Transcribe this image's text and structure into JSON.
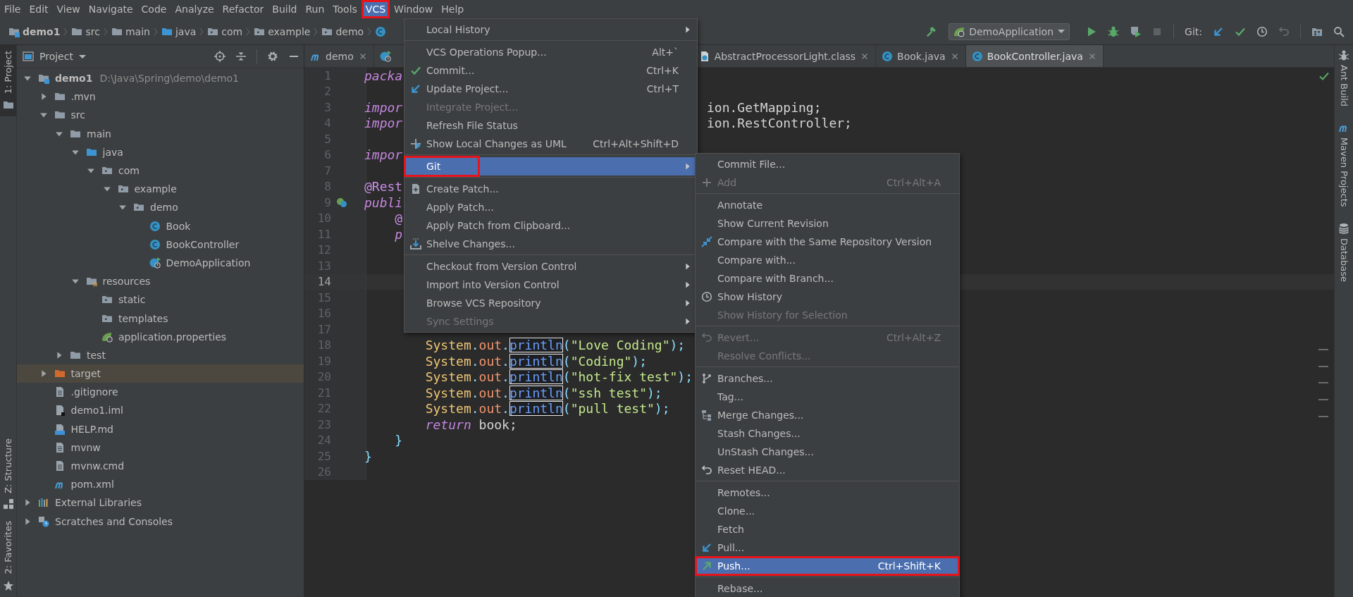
{
  "menubar": {
    "items": [
      {
        "label": "File",
        "selected": false,
        "framed": false
      },
      {
        "label": "Edit",
        "selected": false,
        "framed": false
      },
      {
        "label": "View",
        "selected": false,
        "framed": false
      },
      {
        "label": "Navigate",
        "selected": false,
        "framed": false
      },
      {
        "label": "Code",
        "selected": false,
        "framed": false
      },
      {
        "label": "Analyze",
        "selected": false,
        "framed": false
      },
      {
        "label": "Refactor",
        "selected": false,
        "framed": false
      },
      {
        "label": "Build",
        "selected": false,
        "framed": false
      },
      {
        "label": "Run",
        "selected": false,
        "framed": false
      },
      {
        "label": "Tools",
        "selected": false,
        "framed": false
      },
      {
        "label": "VCS",
        "selected": true,
        "framed": true
      },
      {
        "label": "Window",
        "selected": false,
        "framed": false
      },
      {
        "label": "Help",
        "selected": false,
        "framed": false
      }
    ]
  },
  "toolbar": {
    "breadcrumbs": [
      {
        "label": "demo1",
        "kind": "module"
      },
      {
        "label": "src",
        "kind": "folder"
      },
      {
        "label": "main",
        "kind": "folder"
      },
      {
        "label": "java",
        "kind": "folder_source"
      },
      {
        "label": "com",
        "kind": "package"
      },
      {
        "label": "example",
        "kind": "package"
      },
      {
        "label": "demo",
        "kind": "package"
      },
      {
        "kind": "class"
      }
    ],
    "run_configuration": "DemoApplication",
    "git_label": "Git:"
  },
  "left_stripe": {
    "top": [
      {
        "label": "1: Project",
        "kind": "folder",
        "selected": true
      }
    ],
    "bottom": [
      {
        "label": "Z: Structure",
        "kind": "structure",
        "selected": false
      },
      {
        "label": "2: Favorites",
        "kind": "star",
        "selected": false
      }
    ]
  },
  "right_stripe": [
    {
      "label": "Ant Build",
      "kind": "ant"
    },
    {
      "label": "Maven Projects",
      "kind": "maven"
    },
    {
      "label": "Database",
      "kind": "database"
    }
  ],
  "project": {
    "title": "Project",
    "tree": [
      {
        "label": "demo1",
        "path": "D:\\Java\\Spring\\demo\\demo1",
        "kind": "module",
        "expanded": true,
        "selected": false,
        "children": [
          {
            "label": ".mvn",
            "kind": "folder",
            "expanded": false,
            "selected": false
          },
          {
            "label": "src",
            "kind": "folder",
            "expanded": true,
            "selected": false,
            "children": [
              {
                "label": "main",
                "kind": "folder",
                "expanded": true,
                "selected": false,
                "children": [
                  {
                    "label": "java",
                    "kind": "folder_source",
                    "expanded": true,
                    "selected": false,
                    "children": [
                      {
                        "label": "com",
                        "kind": "package",
                        "expanded": true,
                        "selected": false,
                        "children": [
                          {
                            "label": "example",
                            "kind": "package",
                            "expanded": true,
                            "selected": false,
                            "children": [
                              {
                                "label": "demo",
                                "kind": "package",
                                "expanded": true,
                                "selected": false,
                                "children": [
                                  {
                                    "label": "Book",
                                    "kind": "class",
                                    "selected": false
                                  },
                                  {
                                    "label": "BookController",
                                    "kind": "class",
                                    "selected": false
                                  },
                                  {
                                    "label": "DemoApplication",
                                    "kind": "spring_class",
                                    "selected": false
                                  }
                                ]
                              }
                            ]
                          }
                        ]
                      }
                    ]
                  },
                  {
                    "label": "resources",
                    "kind": "resources",
                    "expanded": true,
                    "selected": false,
                    "children": [
                      {
                        "label": "static",
                        "kind": "package",
                        "selected": false
                      },
                      {
                        "label": "templates",
                        "kind": "package",
                        "selected": false
                      },
                      {
                        "label": "application.properties",
                        "kind": "spring_props",
                        "selected": false
                      }
                    ]
                  }
                ]
              },
              {
                "label": "test",
                "kind": "folder",
                "expanded": false,
                "selected": false
              }
            ]
          },
          {
            "label": "target",
            "kind": "excluded",
            "expanded": false,
            "selected": true
          },
          {
            "label": ".gitignore",
            "kind": "file",
            "selected": false
          },
          {
            "label": "demo1.iml",
            "kind": "iml",
            "selected": false
          },
          {
            "label": "HELP.md",
            "kind": "md",
            "selected": false
          },
          {
            "label": "mvnw",
            "kind": "file",
            "selected": false
          },
          {
            "label": "mvnw.cmd",
            "kind": "file",
            "selected": false
          },
          {
            "label": "pom.xml",
            "kind": "maven",
            "selected": false
          }
        ]
      },
      {
        "label": "External Libraries",
        "kind": "libraries",
        "expanded": false,
        "selected": false
      },
      {
        "label": "Scratches and Consoles",
        "kind": "scratches",
        "expanded": false,
        "selected": false
      }
    ]
  },
  "editor": {
    "tabs": [
      {
        "label": "demo",
        "kind": "maven",
        "selected": false
      },
      {
        "kind": "spring_class",
        "selected": false
      },
      {
        "label": "AbstractProcessorLight.class",
        "kind": "class_file",
        "selected": false
      },
      {
        "label": "Book.java",
        "kind": "class",
        "selected": false
      },
      {
        "label": "BookController.java",
        "kind": "class",
        "selected": true
      }
    ],
    "lines": [
      {
        "number": "1",
        "kind": "plain",
        "current": false,
        "segments": [
          {
            "kind": "keyword",
            "text": "packa"
          }
        ]
      },
      {
        "number": "2",
        "kind": "plain",
        "current": false
      },
      {
        "number": "3",
        "kind": "plain",
        "current": false,
        "segments": [
          {
            "kind": "keyword",
            "text": "impor"
          }
        ],
        "tail": [
          {
            "kind": "plain",
            "text": "ion.GetMapping;"
          }
        ]
      },
      {
        "number": "4",
        "kind": "plain",
        "current": false,
        "segments": [
          {
            "kind": "keyword",
            "text": "impor"
          }
        ],
        "tail": [
          {
            "kind": "plain",
            "text": "ion.RestController;"
          }
        ]
      },
      {
        "number": "5",
        "kind": "plain",
        "current": false
      },
      {
        "number": "6",
        "kind": "plain",
        "current": false,
        "segments": [
          {
            "kind": "keyword",
            "text": "impor"
          }
        ]
      },
      {
        "number": "7",
        "kind": "plain",
        "current": false
      },
      {
        "number": "8",
        "kind": "plain",
        "current": false,
        "segments": [
          {
            "kind": "annotation",
            "text": "@Rest"
          }
        ]
      },
      {
        "number": "9",
        "kind": "bean",
        "current": false,
        "segments": [
          {
            "kind": "keyword",
            "text": "publi"
          }
        ]
      },
      {
        "number": "10",
        "kind": "plain",
        "current": false,
        "segments": [
          {
            "kind": "annotation",
            "text": "    @"
          }
        ]
      },
      {
        "number": "11",
        "kind": "plain",
        "current": false,
        "segments": [
          {
            "kind": "keyword",
            "text": "    p"
          }
        ]
      },
      {
        "number": "12",
        "kind": "plain",
        "current": false
      },
      {
        "number": "13",
        "kind": "plain",
        "current": false
      },
      {
        "number": "14",
        "kind": "plain",
        "current": true
      },
      {
        "number": "15",
        "kind": "plain",
        "current": false
      },
      {
        "number": "16",
        "kind": "plain",
        "current": false
      },
      {
        "number": "17",
        "kind": "plain",
        "current": false
      },
      {
        "number": "18",
        "kind": "plain",
        "current": false,
        "segments": [
          {
            "kind": "class",
            "text": "        System"
          },
          {
            "kind": "punct",
            "text": "."
          },
          {
            "kind": "field",
            "text": "out"
          },
          {
            "kind": "punct",
            "text": "."
          },
          {
            "kind": "method_box",
            "text": "println"
          },
          {
            "kind": "punct",
            "text": "("
          },
          {
            "kind": "string",
            "text": "\"Love Coding\""
          },
          {
            "kind": "punct",
            "text": ");"
          }
        ]
      },
      {
        "number": "19",
        "kind": "plain",
        "current": false,
        "segments": [
          {
            "kind": "class",
            "text": "        System"
          },
          {
            "kind": "punct",
            "text": "."
          },
          {
            "kind": "field",
            "text": "out"
          },
          {
            "kind": "punct",
            "text": "."
          },
          {
            "kind": "method_box",
            "text": "println"
          },
          {
            "kind": "punct",
            "text": "("
          },
          {
            "kind": "string",
            "text": "\"Coding\""
          },
          {
            "kind": "punct",
            "text": ");"
          }
        ]
      },
      {
        "number": "20",
        "kind": "plain",
        "current": false,
        "segments": [
          {
            "kind": "class",
            "text": "        System"
          },
          {
            "kind": "punct",
            "text": "."
          },
          {
            "kind": "field",
            "text": "out"
          },
          {
            "kind": "punct",
            "text": "."
          },
          {
            "kind": "method_box",
            "text": "println"
          },
          {
            "kind": "punct",
            "text": "("
          },
          {
            "kind": "string",
            "text": "\"hot-fix test\""
          },
          {
            "kind": "punct",
            "text": ");"
          }
        ]
      },
      {
        "number": "21",
        "kind": "plain",
        "current": false,
        "segments": [
          {
            "kind": "class",
            "text": "        System"
          },
          {
            "kind": "punct",
            "text": "."
          },
          {
            "kind": "field",
            "text": "out"
          },
          {
            "kind": "punct",
            "text": "."
          },
          {
            "kind": "method_box",
            "text": "println"
          },
          {
            "kind": "punct",
            "text": "("
          },
          {
            "kind": "string",
            "text": "\"ssh test\""
          },
          {
            "kind": "punct",
            "text": ");"
          }
        ]
      },
      {
        "number": "22",
        "kind": "plain",
        "current": false,
        "segments": [
          {
            "kind": "class",
            "text": "        System"
          },
          {
            "kind": "punct",
            "text": "."
          },
          {
            "kind": "field",
            "text": "out"
          },
          {
            "kind": "punct",
            "text": "."
          },
          {
            "kind": "method_box",
            "text": "println"
          },
          {
            "kind": "punct",
            "text": "("
          },
          {
            "kind": "string",
            "text": "\"pull test\""
          },
          {
            "kind": "punct",
            "text": ");"
          }
        ]
      },
      {
        "number": "23",
        "kind": "plain",
        "current": false,
        "segments": [
          {
            "kind": "keyword",
            "text": "        return"
          },
          {
            "kind": "plain",
            "text": " book;"
          }
        ]
      },
      {
        "number": "24",
        "kind": "plain",
        "current": false,
        "segments": [
          {
            "kind": "punct",
            "text": "    }"
          }
        ]
      },
      {
        "number": "25",
        "kind": "plain",
        "current": false,
        "segments": [
          {
            "kind": "punct",
            "text": "}"
          }
        ]
      },
      {
        "number": "26",
        "kind": "plain",
        "current": false
      }
    ]
  },
  "vcs_menu": {
    "items": [
      {
        "kind": "plain",
        "label": "Local History",
        "submenu": true,
        "disabled": false,
        "selected": false,
        "framed": false
      },
      {
        "kind": "separator"
      },
      {
        "kind": "plain",
        "label": "VCS Operations Popup...",
        "shortcut": "Alt+`",
        "submenu": false,
        "disabled": false,
        "selected": false,
        "framed": false
      },
      {
        "kind": "check",
        "label": "Commit...",
        "shortcut": "Ctrl+K",
        "submenu": false,
        "disabled": false,
        "selected": false,
        "framed": false
      },
      {
        "kind": "update",
        "label": "Update Project...",
        "shortcut": "Ctrl+T",
        "submenu": false,
        "disabled": false,
        "selected": false,
        "framed": false
      },
      {
        "kind": "plain",
        "label": "Integrate Project...",
        "submenu": false,
        "disabled": true,
        "selected": false,
        "framed": false
      },
      {
        "kind": "plain",
        "label": "Refresh File Status",
        "submenu": false,
        "disabled": false,
        "selected": false,
        "framed": false
      },
      {
        "kind": "uml",
        "label": "Show Local Changes as UML",
        "shortcut": "Ctrl+Alt+Shift+D",
        "submenu": false,
        "disabled": false,
        "selected": false,
        "framed": false
      },
      {
        "kind": "separator"
      },
      {
        "kind": "plain",
        "label": "Git",
        "submenu": true,
        "disabled": false,
        "selected": true,
        "framed": true
      },
      {
        "kind": "separator"
      },
      {
        "kind": "patch",
        "label": "Create Patch...",
        "submenu": false,
        "disabled": false,
        "selected": false,
        "framed": false
      },
      {
        "kind": "plain",
        "label": "Apply Patch...",
        "submenu": false,
        "disabled": false,
        "selected": false,
        "framed": false
      },
      {
        "kind": "plain",
        "label": "Apply Patch from Clipboard...",
        "submenu": false,
        "disabled": false,
        "selected": false,
        "framed": false
      },
      {
        "kind": "shelve",
        "label": "Shelve Changes...",
        "submenu": false,
        "disabled": false,
        "selected": false,
        "framed": false
      },
      {
        "kind": "separator"
      },
      {
        "kind": "plain",
        "label": "Checkout from Version Control",
        "submenu": true,
        "disabled": false,
        "selected": false,
        "framed": false
      },
      {
        "kind": "plain",
        "label": "Import into Version Control",
        "submenu": true,
        "disabled": false,
        "selected": false,
        "framed": false
      },
      {
        "kind": "plain",
        "label": "Browse VCS Repository",
        "submenu": true,
        "disabled": false,
        "selected": false,
        "framed": false
      },
      {
        "kind": "plain",
        "label": "Sync Settings",
        "submenu": true,
        "disabled": true,
        "selected": false,
        "framed": false
      }
    ]
  },
  "git_menu": {
    "items": [
      {
        "kind": "plain",
        "label": "Commit File...",
        "submenu": false,
        "disabled": false,
        "selected": false,
        "framed": false
      },
      {
        "kind": "plus",
        "label": "Add",
        "shortcut": "Ctrl+Alt+A",
        "submenu": false,
        "disabled": true,
        "selected": false,
        "framed": false
      },
      {
        "kind": "separator"
      },
      {
        "kind": "plain",
        "label": "Annotate",
        "submenu": false,
        "disabled": false,
        "selected": false,
        "framed": false
      },
      {
        "kind": "plain",
        "label": "Show Current Revision",
        "submenu": false,
        "disabled": false,
        "selected": false,
        "framed": false
      },
      {
        "kind": "compare",
        "label": "Compare with the Same Repository Version",
        "submenu": false,
        "disabled": false,
        "selected": false,
        "framed": false
      },
      {
        "kind": "plain",
        "label": "Compare with...",
        "submenu": false,
        "disabled": false,
        "selected": false,
        "framed": false
      },
      {
        "kind": "plain",
        "label": "Compare with Branch...",
        "submenu": false,
        "disabled": false,
        "selected": false,
        "framed": false
      },
      {
        "kind": "clock",
        "label": "Show History",
        "submenu": false,
        "disabled": false,
        "selected": false,
        "framed": false
      },
      {
        "kind": "plain",
        "label": "Show History for Selection",
        "submenu": false,
        "disabled": true,
        "selected": false,
        "framed": false
      },
      {
        "kind": "separator"
      },
      {
        "kind": "revert",
        "label": "Revert...",
        "shortcut": "Ctrl+Alt+Z",
        "submenu": false,
        "disabled": true,
        "selected": false,
        "framed": false
      },
      {
        "kind": "plain",
        "label": "Resolve Conflicts...",
        "submenu": false,
        "disabled": true,
        "selected": false,
        "framed": false
      },
      {
        "kind": "separator"
      },
      {
        "kind": "branches",
        "label": "Branches...",
        "submenu": false,
        "disabled": false,
        "selected": false,
        "framed": false
      },
      {
        "kind": "plain",
        "label": "Tag...",
        "submenu": false,
        "disabled": false,
        "selected": false,
        "framed": false
      },
      {
        "kind": "merge",
        "label": "Merge Changes...",
        "submenu": false,
        "disabled": false,
        "selected": false,
        "framed": false
      },
      {
        "kind": "plain",
        "label": "Stash Changes...",
        "submenu": false,
        "disabled": false,
        "selected": false,
        "framed": false
      },
      {
        "kind": "plain",
        "label": "UnStash Changes...",
        "submenu": false,
        "disabled": false,
        "selected": false,
        "framed": false
      },
      {
        "kind": "reset",
        "label": "Reset HEAD...",
        "submenu": false,
        "disabled": false,
        "selected": false,
        "framed": false
      },
      {
        "kind": "separator"
      },
      {
        "kind": "plain",
        "label": "Remotes...",
        "submenu": false,
        "disabled": false,
        "selected": false,
        "framed": false
      },
      {
        "kind": "plain",
        "label": "Clone...",
        "submenu": false,
        "disabled": false,
        "selected": false,
        "framed": false
      },
      {
        "kind": "plain",
        "label": "Fetch",
        "submenu": false,
        "disabled": false,
        "selected": false,
        "framed": false
      },
      {
        "kind": "pull",
        "label": "Pull...",
        "submenu": false,
        "disabled": false,
        "selected": false,
        "framed": false
      },
      {
        "kind": "push",
        "label": "Push...",
        "shortcut": "Ctrl+Shift+K",
        "submenu": false,
        "disabled": false,
        "selected": true,
        "framed": true
      },
      {
        "kind": "separator"
      },
      {
        "kind": "plain",
        "label": "Rebase...",
        "submenu": false,
        "disabled": false,
        "selected": false,
        "framed": false
      }
    ]
  }
}
